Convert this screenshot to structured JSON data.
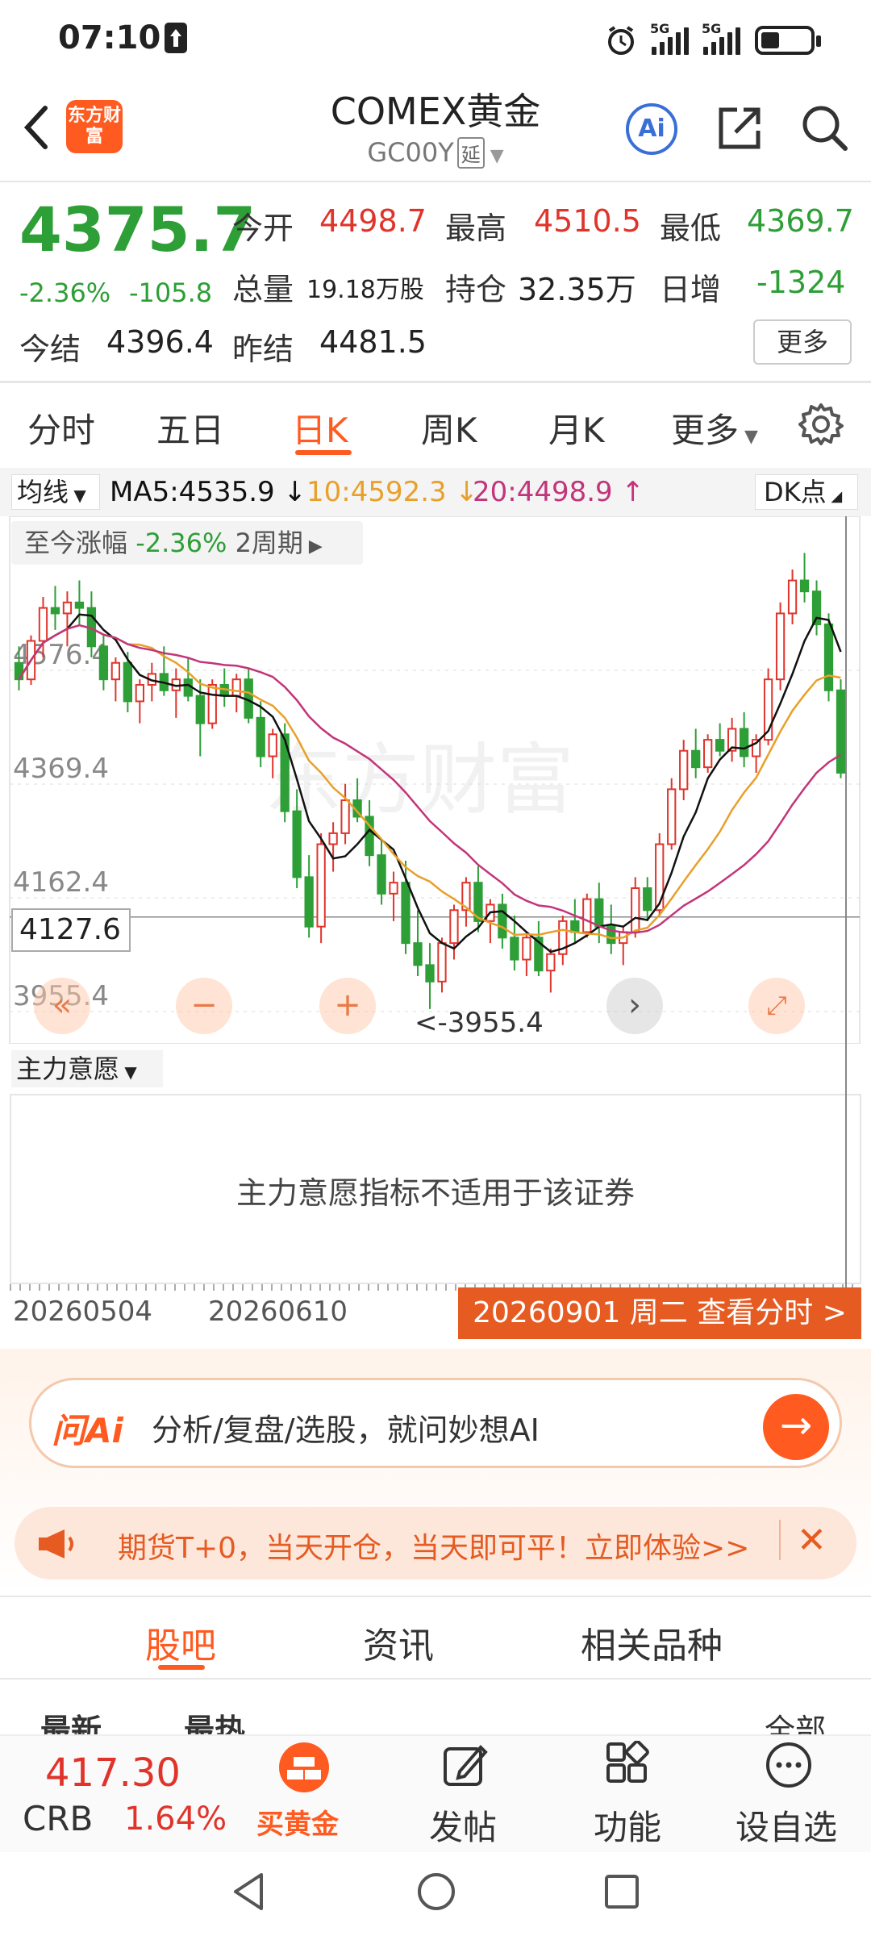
{
  "status": {
    "time": "07:10",
    "net1": "5G",
    "net2": "5G"
  },
  "header": {
    "title": "COMEX黄金",
    "code": "GC00Y",
    "delay_tag": "延",
    "logo_text": "东方财富",
    "ai_label": "Ai"
  },
  "quote": {
    "price": "4375.7",
    "change_pct": "-2.36%",
    "change": "-105.8",
    "open_label": "今开",
    "open": "4498.7",
    "high_label": "最高",
    "high": "4510.5",
    "low_label": "最低",
    "low": "4369.7",
    "volume_label": "总量",
    "volume": "19.18万股",
    "position_label": "持仓",
    "position": "32.35万",
    "daily_inc_label": "日增",
    "daily_inc": "-1324",
    "settle_label": "今结",
    "settle": "4396.4",
    "prev_settle_label": "昨结",
    "prev_settle": "4481.5",
    "more": "更多"
  },
  "tabs": [
    "分时",
    "五日",
    "日K",
    "周K",
    "月K",
    "更多"
  ],
  "ma": {
    "select": "均线",
    "ma5": "MA5:4535.9",
    "ma10": "10:4592.3",
    "ma20": "20:4498.9",
    "dk": "DK点"
  },
  "chart": {
    "range_label": "至今涨幅",
    "range_pct": "-2.36%",
    "range_period": "2周期",
    "cross_value": "4127.6",
    "min_label": "<-3955.4",
    "watermark": "东方财富",
    "colors": {
      "up": "#e0342b",
      "down": "#2e9e37",
      "ma5": "#111111",
      "ma10": "#e8a02a",
      "ma20": "#c2357a"
    }
  },
  "chart_data": {
    "type": "candlestick",
    "yticks": [
      "4576.4",
      "4369.4",
      "4162.4",
      "3955.4"
    ],
    "ylim": [
      3955.4,
      4783.4
    ],
    "x_labels": [
      "20260504",
      "20260610"
    ],
    "candles": [
      [
        4590,
        4620,
        4540,
        4560
      ],
      [
        4560,
        4640,
        4550,
        4630
      ],
      [
        4630,
        4710,
        4600,
        4690
      ],
      [
        4690,
        4730,
        4650,
        4680
      ],
      [
        4680,
        4720,
        4620,
        4700
      ],
      [
        4700,
        4740,
        4660,
        4690
      ],
      [
        4690,
        4720,
        4600,
        4620
      ],
      [
        4620,
        4640,
        4540,
        4560
      ],
      [
        4560,
        4600,
        4520,
        4590
      ],
      [
        4590,
        4610,
        4500,
        4520
      ],
      [
        4520,
        4560,
        4480,
        4550
      ],
      [
        4550,
        4590,
        4520,
        4570
      ],
      [
        4570,
        4620,
        4530,
        4540
      ],
      [
        4540,
        4580,
        4490,
        4560
      ],
      [
        4560,
        4600,
        4520,
        4530
      ],
      [
        4530,
        4560,
        4420,
        4480
      ],
      [
        4480,
        4560,
        4470,
        4550
      ],
      [
        4550,
        4580,
        4510,
        4530
      ],
      [
        4530,
        4570,
        4500,
        4560
      ],
      [
        4560,
        4580,
        4480,
        4490
      ],
      [
        4490,
        4520,
        4400,
        4420
      ],
      [
        4420,
        4470,
        4380,
        4460
      ],
      [
        4460,
        4480,
        4300,
        4320
      ],
      [
        4320,
        4360,
        4180,
        4200
      ],
      [
        4200,
        4240,
        4090,
        4110
      ],
      [
        4110,
        4280,
        4080,
        4260
      ],
      [
        4260,
        4300,
        4210,
        4280
      ],
      [
        4280,
        4370,
        4260,
        4340
      ],
      [
        4340,
        4380,
        4300,
        4310
      ],
      [
        4310,
        4340,
        4220,
        4240
      ],
      [
        4240,
        4270,
        4150,
        4170
      ],
      [
        4170,
        4210,
        4120,
        4190
      ],
      [
        4190,
        4230,
        4060,
        4080
      ],
      [
        4080,
        4140,
        4020,
        4040
      ],
      [
        4040,
        4080,
        3960,
        4010
      ],
      [
        4010,
        4090,
        3990,
        4080
      ],
      [
        4080,
        4150,
        4050,
        4140
      ],
      [
        4140,
        4200,
        4110,
        4190
      ],
      [
        4190,
        4220,
        4100,
        4120
      ],
      [
        4120,
        4160,
        4080,
        4150
      ],
      [
        4150,
        4170,
        4070,
        4090
      ],
      [
        4090,
        4130,
        4030,
        4050
      ],
      [
        4050,
        4100,
        4020,
        4090
      ],
      [
        4090,
        4120,
        4020,
        4030
      ],
      [
        4030,
        4070,
        3990,
        4060
      ],
      [
        4060,
        4130,
        4040,
        4120
      ],
      [
        4120,
        4160,
        4080,
        4100
      ],
      [
        4100,
        4170,
        4090,
        4160
      ],
      [
        4160,
        4190,
        4080,
        4110
      ],
      [
        4110,
        4150,
        4060,
        4080
      ],
      [
        4080,
        4110,
        4040,
        4100
      ],
      [
        4100,
        4200,
        4090,
        4180
      ],
      [
        4180,
        4200,
        4120,
        4140
      ],
      [
        4140,
        4280,
        4130,
        4260
      ],
      [
        4260,
        4380,
        4250,
        4360
      ],
      [
        4360,
        4450,
        4340,
        4430
      ],
      [
        4430,
        4470,
        4380,
        4400
      ],
      [
        4400,
        4460,
        4390,
        4450
      ],
      [
        4450,
        4480,
        4420,
        4430
      ],
      [
        4430,
        4490,
        4410,
        4470
      ],
      [
        4470,
        4500,
        4400,
        4420
      ],
      [
        4420,
        4460,
        4390,
        4450
      ],
      [
        4450,
        4580,
        4440,
        4560
      ],
      [
        4560,
        4700,
        4540,
        4680
      ],
      [
        4680,
        4760,
        4660,
        4740
      ],
      [
        4740,
        4790,
        4700,
        4720
      ],
      [
        4720,
        4740,
        4640,
        4660
      ],
      [
        4660,
        4680,
        4520,
        4540
      ],
      [
        4540,
        4560,
        4380,
        4390
      ]
    ]
  },
  "indicator": {
    "select": "主力意愿",
    "message": "主力意愿指标不适用于该证券"
  },
  "date_pill": "20260901 周二 查看分时 >",
  "ask_ai": {
    "logo": "问Ai",
    "placeholder": "分析/复盘/选股，就问妙想AI"
  },
  "promo": {
    "text": "期货T+0，当天开仓，当天即可平！立即体验>>"
  },
  "sub_tabs": [
    "股吧",
    "资讯",
    "相关品种"
  ],
  "filters": {
    "latest": "最新",
    "hot": "最热",
    "all": "全部"
  },
  "bottom": {
    "crb_price": "417.30",
    "crb_name": "CRB",
    "crb_chg": "1.64%",
    "buy_gold": "买黄金",
    "post": "发帖",
    "func": "功能",
    "watch": "设自选"
  }
}
